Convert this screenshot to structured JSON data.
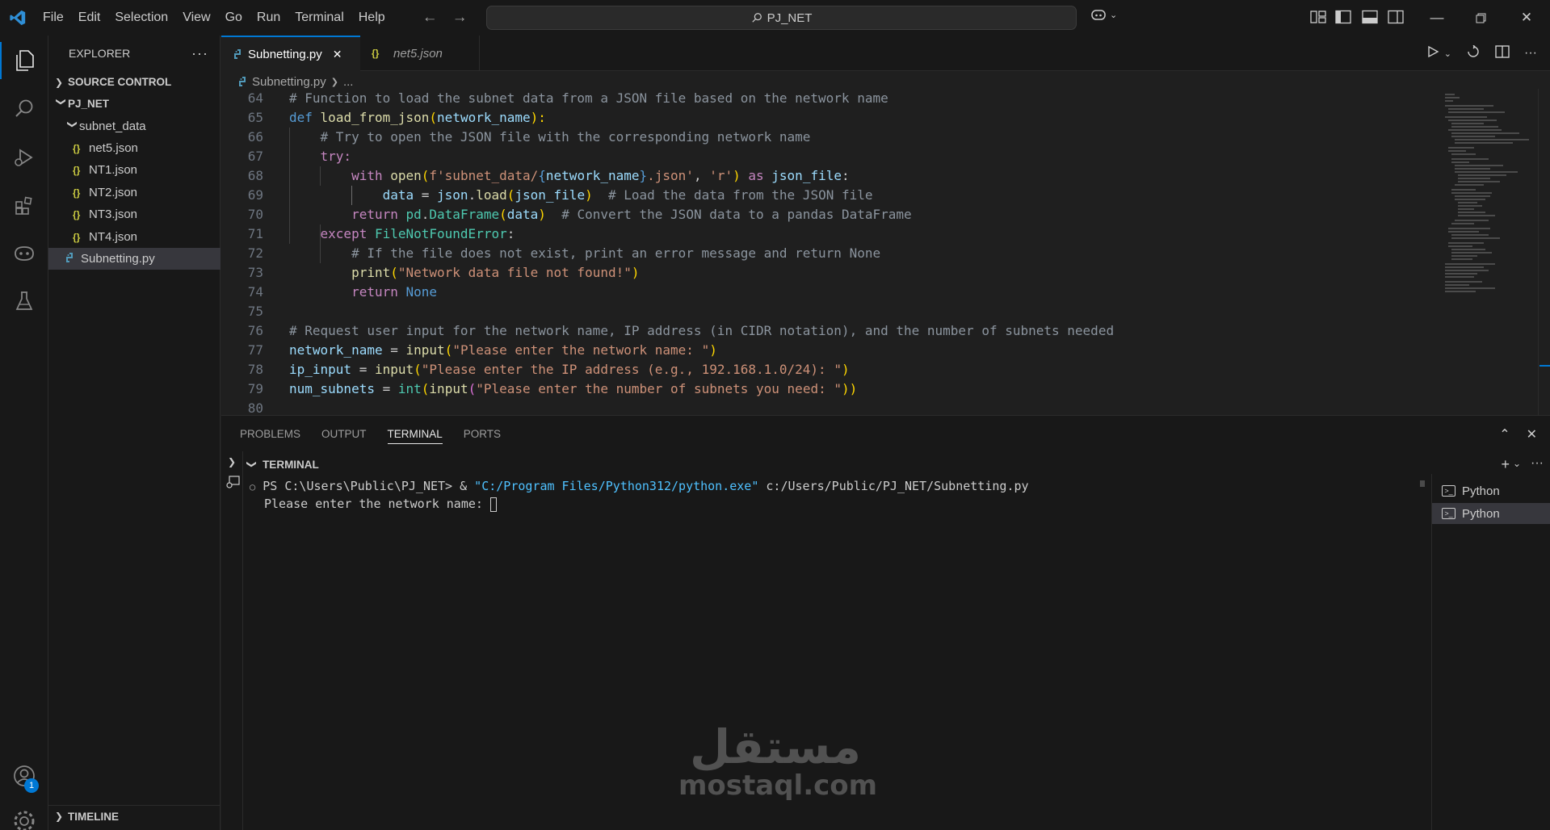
{
  "menu": [
    "File",
    "Edit",
    "Selection",
    "View",
    "Go",
    "Run",
    "Terminal",
    "Help"
  ],
  "search": {
    "text": "PJ_NET"
  },
  "explorer": {
    "title": "EXPLORER",
    "source_control": "SOURCE CONTROL",
    "project": "PJ_NET",
    "folder": "subnet_data",
    "files": [
      "net5.json",
      "NT1.json",
      "NT2.json",
      "NT3.json",
      "NT4.json"
    ],
    "active_file": "Subnetting.py",
    "timeline": "TIMELINE"
  },
  "accounts_badge": "1",
  "tabs": [
    {
      "label": "Subnetting.py",
      "active": true
    },
    {
      "label": "net5.json",
      "active": false
    }
  ],
  "breadcrumb": {
    "file": "Subnetting.py",
    "rest": "..."
  },
  "code": {
    "line_numbers": [
      "64",
      "65",
      "66",
      "67",
      "68",
      "69",
      "70",
      "71",
      "72",
      "73",
      "74",
      "75",
      "76",
      "77",
      "78",
      "79",
      "80"
    ],
    "l64": "# Function to load the subnet data from a JSON file based on the network name",
    "l65": {
      "a": "def",
      "b": "load_from_json",
      "c": "(",
      "d": "network_name",
      "e": "):"
    },
    "l66": "# Try to open the JSON file with the corresponding network name",
    "l67": "try:",
    "l68": {
      "a": "with",
      "b": "open",
      "c": "(",
      "d": "f'subnet_data/",
      "e": "{",
      "f": "network_name",
      "g": "}",
      "h": ".json'",
      "i": ", ",
      "j": "'r'",
      "k": ")",
      "l": " as ",
      "m": "json_file",
      "n": ":"
    },
    "l69": {
      "a": "data",
      "b": " = ",
      "c": "json",
      "d": ".",
      "e": "load",
      "f": "(",
      "g": "json_file",
      "h": ")",
      "i": "  # Load the data from the JSON file"
    },
    "l70": {
      "a": "return",
      "b": " pd",
      "c": ".",
      "d": "DataFrame",
      "e": "(",
      "f": "data",
      "g": ")",
      "h": "  # Convert the JSON data to a pandas DataFrame"
    },
    "l71": {
      "a": "except",
      "b": " FileNotFoundError",
      "c": ":"
    },
    "l72": "# If the file does not exist, print an error message and return None",
    "l73": {
      "a": "print",
      "b": "(",
      "c": "\"Network data file not found!\"",
      "d": ")"
    },
    "l74": {
      "a": "return",
      "b": " None"
    },
    "l76": "# Request user input for the network name, IP address (in CIDR notation), and the number of subnets needed",
    "l77": {
      "a": "network_name",
      "b": " = ",
      "c": "input",
      "d": "(",
      "e": "\"Please enter the network name: \"",
      "f": ")"
    },
    "l78": {
      "a": "ip_input",
      "b": " = ",
      "c": "input",
      "d": "(",
      "e": "\"Please enter the IP address (e.g., 192.168.1.0/24): \"",
      "f": ")"
    },
    "l79": {
      "a": "num_subnets",
      "b": " = ",
      "c": "int",
      "d": "(",
      "e": "input",
      "f": "(",
      "g": "\"Please enter the number of subnets you need: \"",
      "h": "))"
    }
  },
  "panel": {
    "tabs": [
      "PROBLEMS",
      "OUTPUT",
      "TERMINAL",
      "PORTS"
    ],
    "active_tab": "TERMINAL",
    "terminal_title": "TERMINAL",
    "prompt": "PS C:\\Users\\Public\\PJ_NET> & ",
    "exe": "\"C:/Program Files/Python312/python.exe\"",
    "script": " c:/Users/Public/PJ_NET/Subnetting.py",
    "output": "Please enter the network name: ",
    "instances": [
      "Python",
      "Python"
    ]
  },
  "watermark": {
    "arabic": "مستقل",
    "latin": "mostaql.com"
  },
  "colors": {
    "accent": "#0078d4",
    "background": "#1f1f1f",
    "sidebar": "#181818"
  }
}
